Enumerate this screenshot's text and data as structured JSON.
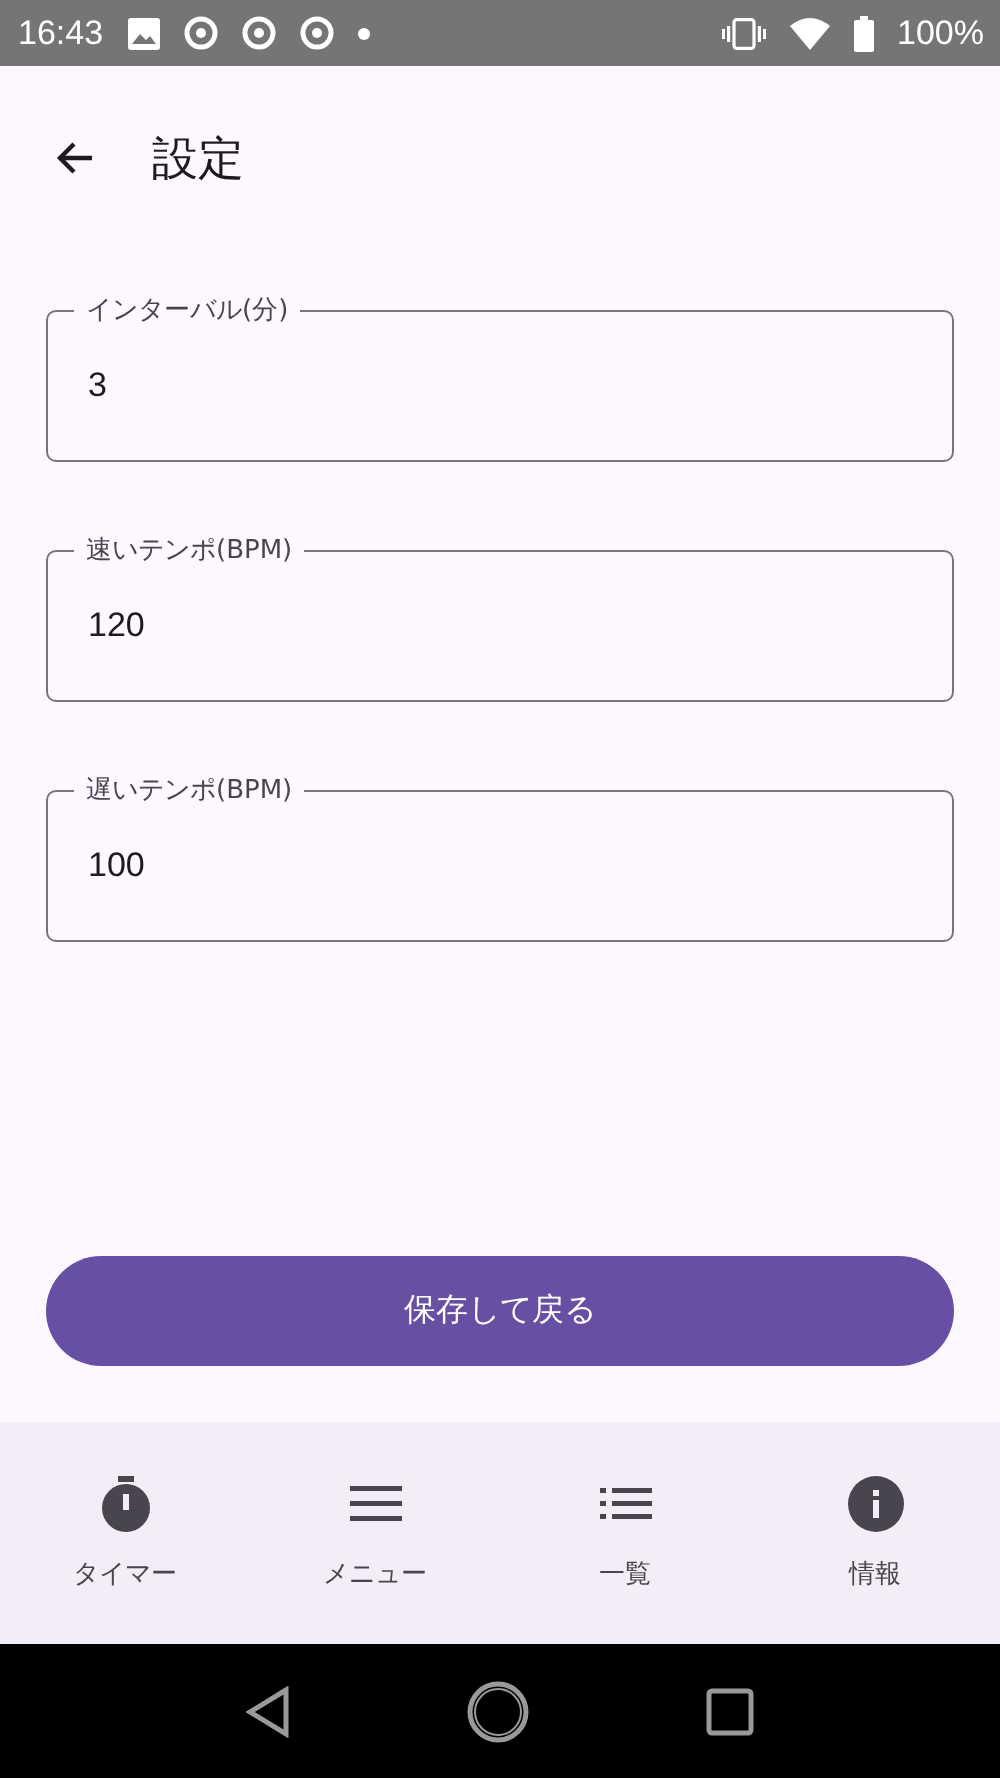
{
  "status_bar": {
    "time": "16:43",
    "battery": "100%"
  },
  "app_bar": {
    "title": "設定"
  },
  "fields": [
    {
      "label": "インターバル(分)",
      "value": "3"
    },
    {
      "label": "速いテンポ(BPM)",
      "value": "120"
    },
    {
      "label": "遅いテンポ(BPM)",
      "value": "100"
    }
  ],
  "save_button": "保存して戻る",
  "bottom_nav": [
    {
      "kind": "timer",
      "label": "タイマー",
      "selected": false
    },
    {
      "kind": "menu",
      "label": "メニュー",
      "selected": false
    },
    {
      "kind": "list",
      "label": "一覧",
      "selected": false
    },
    {
      "kind": "info",
      "label": "情報",
      "selected": false
    }
  ]
}
